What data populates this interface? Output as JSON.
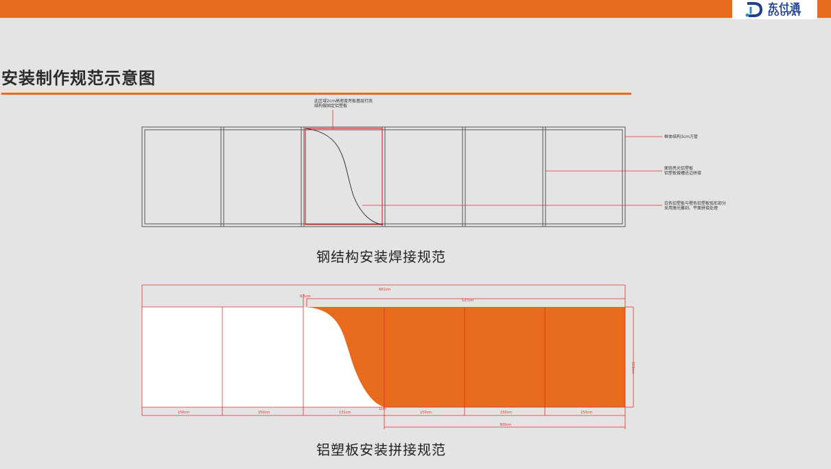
{
  "brand": {
    "name_cn": "东付通",
    "name_en": "DOOPAY"
  },
  "page_title": "安装制作规范示意图",
  "section1": {
    "caption": "钢结构安装焊接规范",
    "notes": {
      "top": "此区域2cm高密度亮板基层打底\n结构做固定铝塑板",
      "frame": "框体结构3cm方管",
      "panel": "面饰亮光铝塑板\n铝塑板做槽达边拼接",
      "curve": "白色铝塑板与橙色铝塑板弧形部分\n采用激光雕刻、平面拼接处理"
    }
  },
  "section2": {
    "caption": "铝塑板安装拼接规范",
    "dims": {
      "total_width": "681cm",
      "orange_width": "537cm",
      "offset": "8.5cm",
      "height": "150cm",
      "seg1": "150cm",
      "seg2": "150cm",
      "seg3": "131cm",
      "seg4": "150cm",
      "seg5": "150cm",
      "seg6": "150cm",
      "gap": "1cm",
      "bottom_span": "300cm"
    }
  },
  "colors": {
    "orange": "#e86a1c",
    "red_line": "#d9302a",
    "frame": "#555555",
    "background": "#e4e4e4"
  }
}
